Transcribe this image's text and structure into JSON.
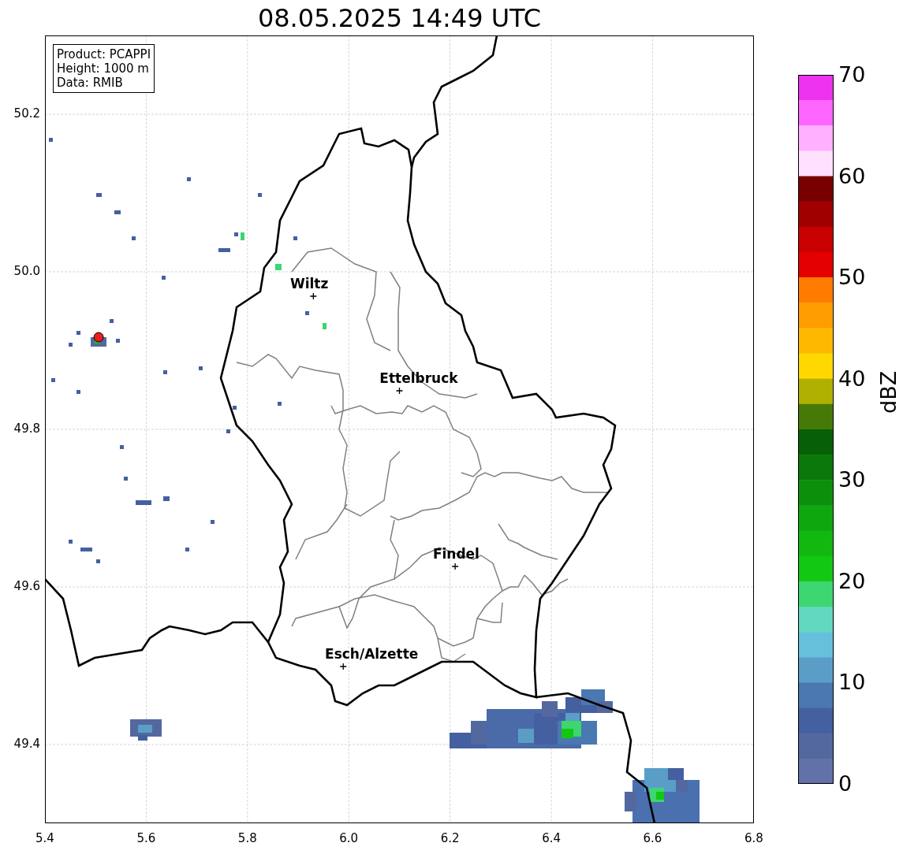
{
  "title": "08.05.2025 14:49 UTC",
  "map": {
    "info": [
      "Product: PCAPPI",
      "Height: 1000 m",
      "Data: RMIB"
    ],
    "cities": [
      "Wiltz",
      "Ettelbruck",
      "Findel",
      "Esch/Alzette"
    ],
    "x_ticks": [
      "5.4",
      "5.6",
      "5.8",
      "6.0",
      "6.2",
      "6.4",
      "6.6",
      "6.8"
    ],
    "y_ticks": [
      "50.2",
      "50.0",
      "49.8",
      "49.6",
      "49.4"
    ]
  },
  "colorbar": {
    "label": "dBZ",
    "ticks": [
      "70",
      "60",
      "50",
      "40",
      "30",
      "20",
      "10",
      "0"
    ],
    "bands": [
      {
        "color": "#ee33ee"
      },
      {
        "color": "#ff66ff"
      },
      {
        "color": "#ffb0ff"
      },
      {
        "color": "#ffe0ff"
      },
      {
        "color": "#780000"
      },
      {
        "color": "#a00000"
      },
      {
        "color": "#c80000"
      },
      {
        "color": "#e40000"
      },
      {
        "color": "#ff7c00"
      },
      {
        "color": "#ff9c00"
      },
      {
        "color": "#ffb800"
      },
      {
        "color": "#ffd800"
      },
      {
        "color": "#b0b000"
      },
      {
        "color": "#467a08"
      },
      {
        "color": "#075f07"
      },
      {
        "color": "#0a780a"
      },
      {
        "color": "#0c900c"
      },
      {
        "color": "#0ea80e"
      },
      {
        "color": "#10b810"
      },
      {
        "color": "#12c812"
      },
      {
        "color": "#3dd670"
      },
      {
        "color": "#62d8c0"
      },
      {
        "color": "#66c0dc"
      },
      {
        "color": "#5a9ec8"
      },
      {
        "color": "#4a78b0"
      },
      {
        "color": "#4560a0"
      },
      {
        "color": "#5468a0"
      },
      {
        "color": "#6272a8"
      }
    ]
  }
}
